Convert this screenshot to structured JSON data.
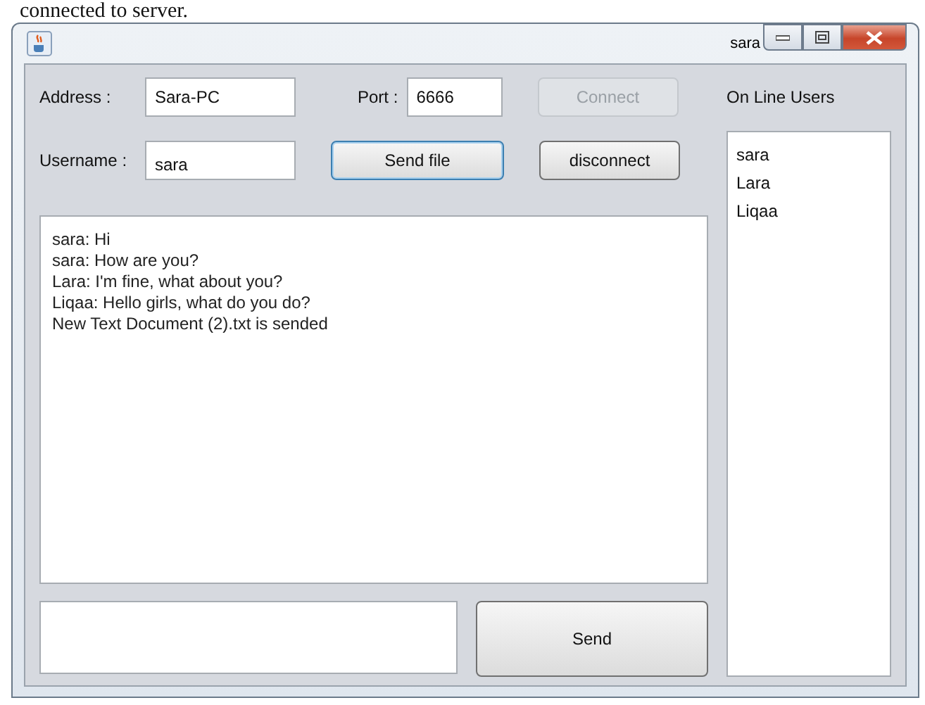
{
  "caption": "connected to server.",
  "window": {
    "title": "sara"
  },
  "connection": {
    "address_label": "Address :",
    "address": "Sara-PC",
    "port_label": "Port :",
    "port": "6666",
    "username_label": "Username :",
    "username": "sara"
  },
  "buttons": [
    {
      "kind": "connect",
      "label": "Connect",
      "disabled": true
    },
    {
      "kind": "send-file",
      "label": "Send file",
      "disabled": false,
      "focused": true
    },
    {
      "kind": "disconnect",
      "label": "disconnect",
      "disabled": false,
      "focused": false
    }
  ],
  "users": {
    "title": "On Line Users",
    "items": [
      "sara",
      "Lara",
      "Liqaa"
    ]
  },
  "messages": [
    "sara:  Hi",
    "sara:  How are you?",
    "Lara:  I'm fine, what about you?",
    "Liqaa:  Hello girls, what do you do?",
    "New Text Document (2).txt is sended"
  ],
  "send_button": {
    "label": "Send"
  }
}
